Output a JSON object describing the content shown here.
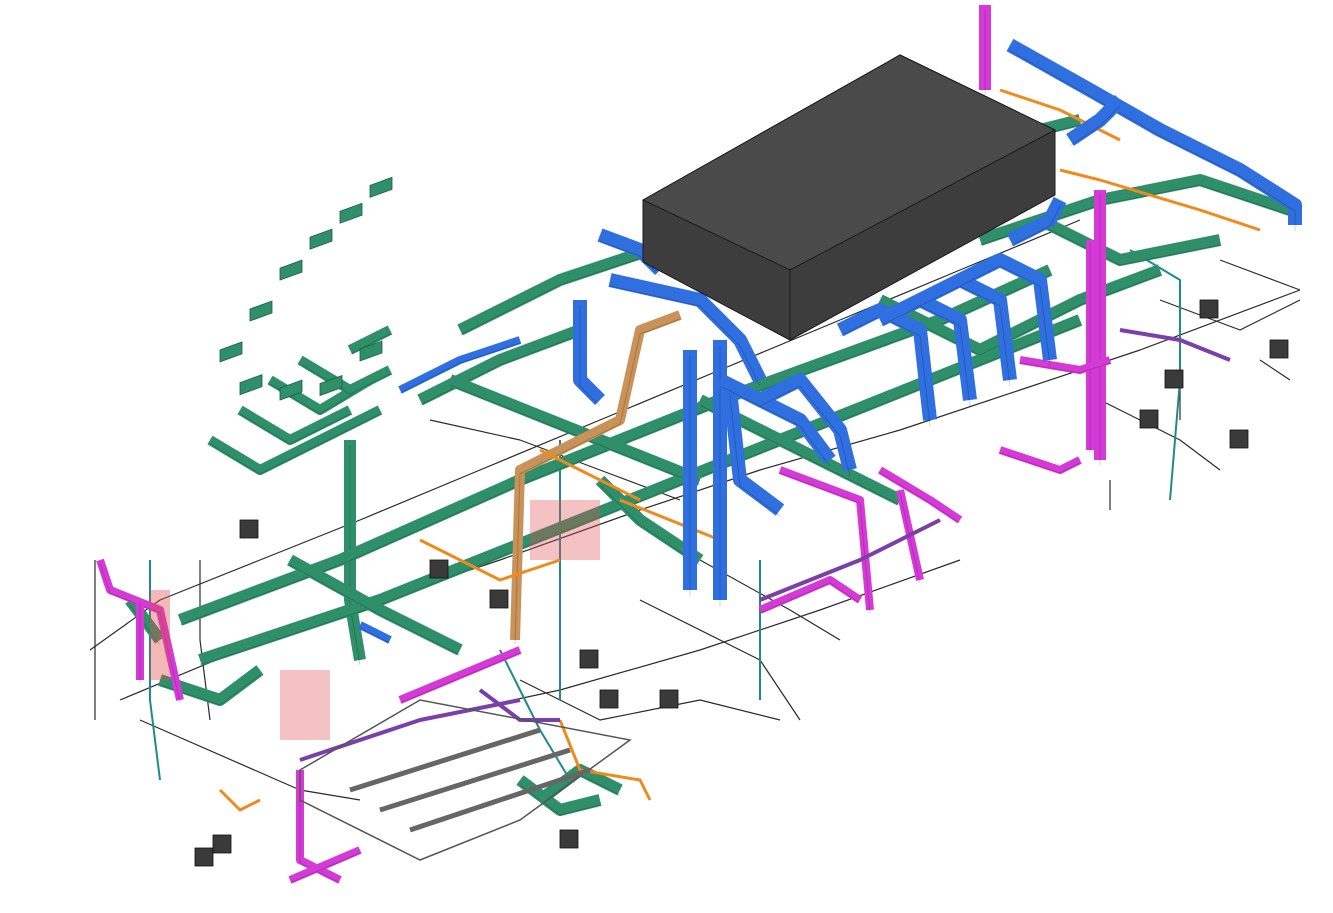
{
  "scene": {
    "view": "isometric",
    "background": "#ffffff",
    "systems": [
      {
        "name": "supply-duct",
        "color": "#2f6fe0"
      },
      {
        "name": "return-duct",
        "color": "#2e8f6a"
      },
      {
        "name": "exhaust-duct",
        "color": "#d63ad6"
      },
      {
        "name": "piping-orange",
        "color": "#f08a1c"
      },
      {
        "name": "piping-tan",
        "color": "#c89258"
      },
      {
        "name": "piping-dark",
        "color": "#2a2a2a"
      },
      {
        "name": "piping-teal",
        "color": "#1f8a8a"
      },
      {
        "name": "piping-purple",
        "color": "#7a3fa8"
      },
      {
        "name": "fire-red",
        "color": "#e05050"
      },
      {
        "name": "equipment",
        "color": "#3a3a3a"
      }
    ],
    "main_equipment": {
      "name": "air-handling-unit",
      "color": "#3d3d3d",
      "top_color": "#4a4a4a"
    }
  }
}
